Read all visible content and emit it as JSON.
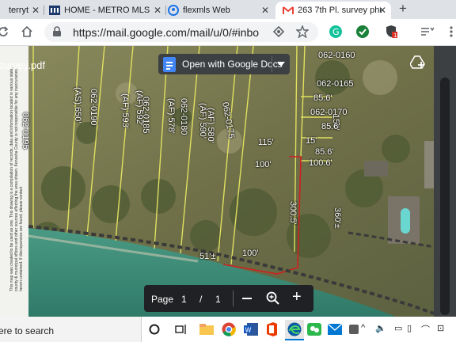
{
  "tabs": [
    {
      "title": "terryt",
      "favicon": "generic-page-icon",
      "active": false
    },
    {
      "title": "HOME - METRO MLS",
      "favicon": "mls-icon",
      "active": false
    },
    {
      "title": "flexmls Web",
      "favicon": "flexmls-icon",
      "active": false
    },
    {
      "title": "263 7th Pl. survey pho",
      "favicon": "gmail-icon",
      "active": true
    }
  ],
  "address_bar": {
    "url": "https://mail.google.com/mail/u/0/#inbo"
  },
  "viewer": {
    "file_name": "survey.pdf",
    "open_with_label": "Open with Google Docs",
    "page_label": "Page",
    "page_current": "1",
    "page_separator": "/",
    "page_total": "1"
  },
  "survey_labels": {
    "parcels": [
      "062-0195",
      "062-0190",
      "062-0185",
      "062-0180",
      "062-0175",
      "062-0170",
      "062-0160",
      "062-0165"
    ],
    "acres": [
      "(AS) 650'",
      "(AF) 593'",
      "(AF) 592'",
      "(AF) 578'",
      "(AF) 580'",
      "(AF) 590'"
    ],
    "dimensions": [
      "115'",
      "100'",
      "100'",
      "51'±",
      "100'",
      "150'",
      "15'",
      "85.6'",
      "85.6'",
      "85.6'",
      "100.6'",
      "360'±",
      "300.5'"
    ],
    "disclaimer": "This map was created to be used as one. This drawing is a compilation of records, data and information located in various state, county & municipal offices and other sources affecting the area shown. Kenosha County is not responsible for any inaccuracies herein contained. If discrepancies are found, please contact"
  },
  "taskbar": {
    "search_placeholder": "ere to search"
  },
  "colors": {
    "tabstrip": "#dee1e6",
    "accent_blue": "#4285f4",
    "viewer_bg": "#202124",
    "lake": "#3d8a77",
    "parcel_line": "#e0e060",
    "boundary": "#d02020"
  }
}
